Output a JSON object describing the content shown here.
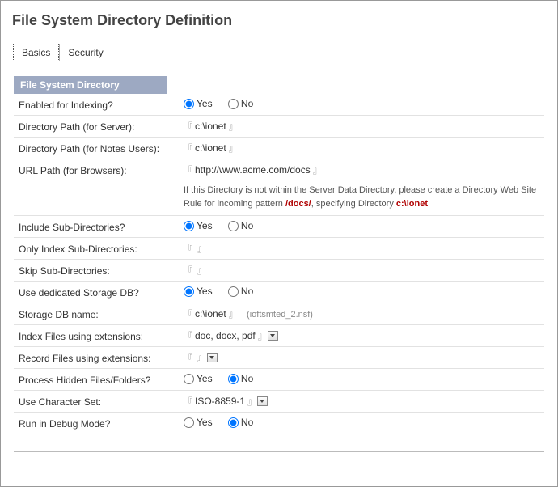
{
  "title": "File System Directory Definition",
  "tabs": {
    "basics": "Basics",
    "security": "Security"
  },
  "section_header": "File System Directory",
  "labels": {
    "enabled": "Enabled for Indexing?",
    "dir_server": "Directory Path (for Server):",
    "dir_notes": "Directory Path (for Notes Users):",
    "url_path": "URL Path (for Browsers):",
    "include_sub": "Include Sub-Directories?",
    "only_index_sub": "Only Index Sub-Directories:",
    "skip_sub": "Skip Sub-Directories:",
    "dedicated_db": "Use dedicated Storage DB?",
    "storage_name": "Storage DB name:",
    "index_ext": "Index Files using extensions:",
    "record_ext": "Record Files using extensions:",
    "hidden": "Process Hidden Files/Folders?",
    "charset": "Use Character Set:",
    "debug": "Run in Debug Mode?"
  },
  "values": {
    "dir_server": "c:\\ionet",
    "dir_notes": "c:\\ionet",
    "url_path": "http://www.acme.com/docs",
    "only_index_sub": "",
    "skip_sub": "",
    "storage_name": "c:\\ionet",
    "storage_hint": "(ioftsmted_2.nsf)",
    "index_ext": "doc, docx, pdf",
    "record_ext": "",
    "charset": "ISO-8859-1"
  },
  "radios": {
    "enabled": "Yes",
    "include_sub": "Yes",
    "dedicated_db": "Yes",
    "hidden": "No",
    "debug": "No"
  },
  "radio_labels": {
    "yes": "Yes",
    "no": "No"
  },
  "note": {
    "pre": "If this Directory is not within the Server Data Directory, please create a Directory Web Site Rule for incoming pattern ",
    "pattern": "/docs/",
    "mid": ", specifying Directory ",
    "dir": "c:\\ionet"
  }
}
